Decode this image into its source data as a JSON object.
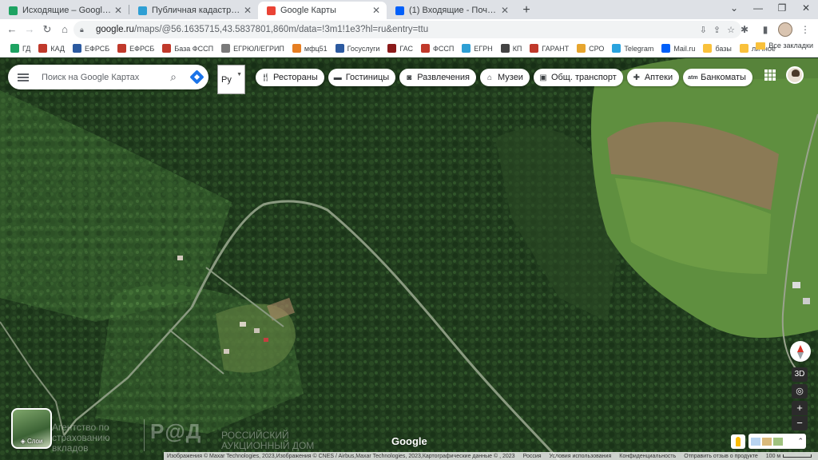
{
  "tabs": [
    {
      "title": "Исходящие – Google Диск",
      "icon": "google-drive-icon",
      "color": "#1ea362"
    },
    {
      "title": "Публичная кадастровая карта",
      "icon": "cadastral-map-icon",
      "color": "#2e9fd4"
    },
    {
      "title": "Google Карты",
      "icon": "google-maps-icon",
      "color": "#ea4335",
      "active": true
    },
    {
      "title": "(1) Входящие - Почта Mail.ru",
      "icon": "mail-icon",
      "color": "#005ff9"
    }
  ],
  "toolbar": {
    "url_main": "google.ru",
    "url_rest": "/maps/@56.1635715,43.5837801,860m/data=!3m1!1e3?hl=ru&entry=ttu"
  },
  "bookmarks": [
    {
      "label": "ГД",
      "color": "#1ea362"
    },
    {
      "label": "КАД",
      "color": "#c0392b"
    },
    {
      "label": "ЕФРСБ",
      "color": "#2c5aa0"
    },
    {
      "label": "ЕФРСБ",
      "color": "#c0392b"
    },
    {
      "label": "База ФССП",
      "color": "#c0392b"
    },
    {
      "label": "ЕГРЮЛ/ЕГРИП",
      "color": "#7a7a7a"
    },
    {
      "label": "мфц51",
      "color": "#e67e22"
    },
    {
      "label": "Госуслуги",
      "color": "#2c5aa0"
    },
    {
      "label": "ГАС",
      "color": "#8b1a1a"
    },
    {
      "label": "ФССП",
      "color": "#c0392b"
    },
    {
      "label": "ЕГРН",
      "color": "#2e9fd4"
    },
    {
      "label": "КП",
      "color": "#444444"
    },
    {
      "label": "ГАРАНТ",
      "color": "#c0392b"
    },
    {
      "label": "СРО",
      "color": "#e6a52e"
    },
    {
      "label": "Telegram",
      "color": "#2aa3de"
    },
    {
      "label": "Mail.ru",
      "color": "#005ff9"
    },
    {
      "label": "базы",
      "color": "#f9c13b"
    },
    {
      "label": "личное",
      "color": "#f9c13b"
    }
  ],
  "bookmarks_all": "Все закладки",
  "search": {
    "placeholder": "Поиск на Google Картах"
  },
  "lang": {
    "value": "Ру"
  },
  "chips": [
    {
      "label": "Рестораны",
      "icon": "restaurant-icon"
    },
    {
      "label": "Гостиницы",
      "icon": "hotel-icon"
    },
    {
      "label": "Развлечения",
      "icon": "camera-icon"
    },
    {
      "label": "Музеи",
      "icon": "museum-icon"
    },
    {
      "label": "Общ. транспорт",
      "icon": "transit-icon"
    },
    {
      "label": "Аптеки",
      "icon": "pharmacy-icon"
    },
    {
      "label": "Банкоматы",
      "icon": "atm-icon"
    }
  ],
  "layers_label": "Слои",
  "watermarks": {
    "agency": "Агентство по страхованию вкладов",
    "rad_logo": "Р@Д",
    "rad_text": "РОССИЙСКИЙ АУКЦИОННЫЙ ДОМ"
  },
  "google_logo": "Google",
  "attribution": {
    "imagery": "Изображения © Maxar Technologies, 2023,Изображения © CNES / Airbus,Maxar Technologies, 2023,Картографические данные © , 2023",
    "country": "Россия",
    "terms": "Условия использования",
    "privacy": "Конфиденциальность",
    "feedback": "Отправить отзыв о продукте",
    "scale": "100 м"
  },
  "controls": {
    "three_d": "3D",
    "zoom_in": "+",
    "zoom_out": "−",
    "collapse": "⌃"
  }
}
